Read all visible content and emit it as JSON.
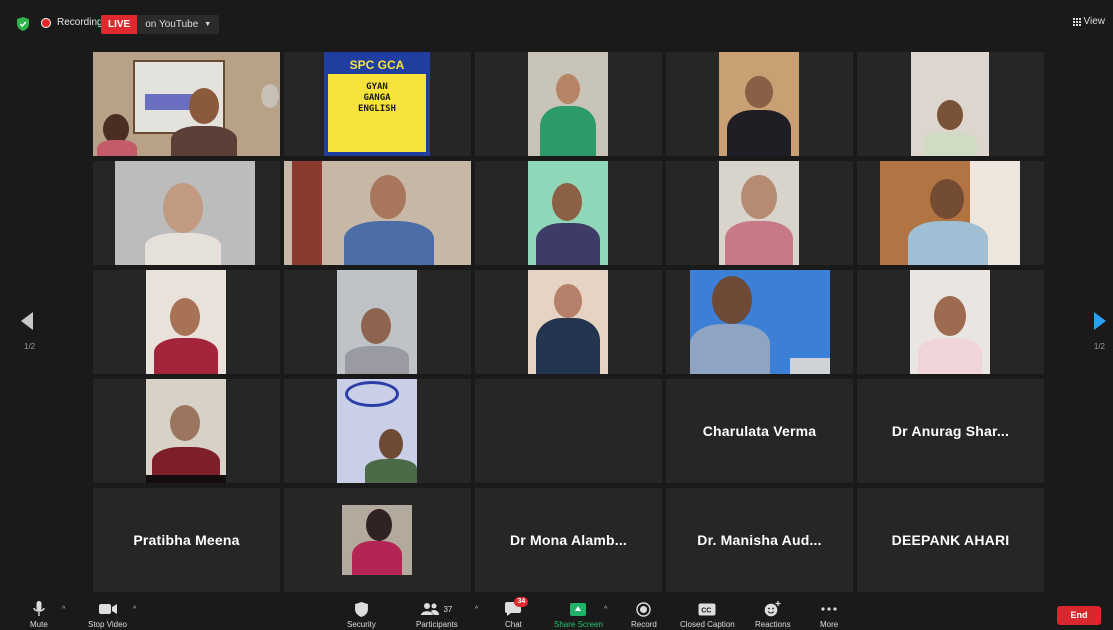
{
  "topbar": {
    "recording_label": "Recording",
    "live_label": "LIVE",
    "stream_label": "on YouTube",
    "view_label": "View"
  },
  "pagination": {
    "left_page": "1/2",
    "right_page": "1/2"
  },
  "gallery": {
    "names": {
      "charulata": "Charulata Verma",
      "anurag": "Dr Anurag Shar...",
      "pratibha": "Pratibha Meena",
      "mona": "Dr Mona Alamb...",
      "manisha": "Dr. Manisha Aud...",
      "deepank": "DEEPANK AHARI"
    },
    "logo": {
      "title": "SPC GCA",
      "line1": "GYAN",
      "line2": "GANGA",
      "line3": "ENGLISH"
    }
  },
  "toolbar": {
    "mute": "Mute",
    "stop_video": "Stop Video",
    "security": "Security",
    "participants": "Participants",
    "participants_count": "37",
    "chat": "Chat",
    "chat_count": "34",
    "share_screen": "Share Screen",
    "record": "Record",
    "closed_caption": "Closed Caption",
    "reactions": "Reactions",
    "more": "More",
    "end": "End"
  },
  "colors": {
    "background": "#1a1a1a",
    "tile": "#262626",
    "active_border": "#c7d95a",
    "live_red": "#e0292f",
    "share_green": "#22b36a",
    "nav_blue": "#2a9df4"
  }
}
